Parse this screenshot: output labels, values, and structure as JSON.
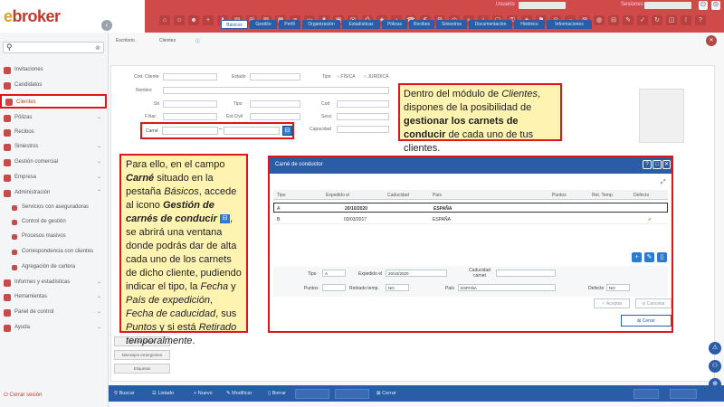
{
  "app": {
    "logo": "ebroker"
  },
  "header": {
    "user_label": "Usuario",
    "session_label": "Sesiones"
  },
  "sidebar": {
    "search_placeholder": "",
    "items": [
      {
        "label": "Invitaciones"
      },
      {
        "label": "Candidatos"
      },
      {
        "label": "Clientes"
      },
      {
        "label": "Pólizas"
      },
      {
        "label": "Recibos"
      },
      {
        "label": "Siniestros"
      },
      {
        "label": "Gestión comercial"
      },
      {
        "label": "Empresa"
      },
      {
        "label": "Administración"
      },
      {
        "label": "Servicios con aseguradoras"
      },
      {
        "label": "Control de gestión"
      },
      {
        "label": "Procesos masivos"
      },
      {
        "label": "Correspondencia con clientes"
      },
      {
        "label": "Agregación de cartera"
      },
      {
        "label": "Informes y estadísticas"
      },
      {
        "label": "Herramientas"
      },
      {
        "label": "Panel de control"
      },
      {
        "label": "Ayuda"
      }
    ],
    "logout": "Cerrar sesión"
  },
  "breadcrumb": {
    "a": "Escritorio",
    "b": "Clientes"
  },
  "tabs": [
    "Básicos",
    "Gestión",
    "Perfil",
    "Organización",
    "Estadísticas",
    "Pólizas",
    "Recibos",
    "Siniestros",
    "Documentación",
    "Histórico",
    "Informaciones"
  ],
  "form": {
    "cod_cliente": "Cód. Cliente",
    "estado": "Estado",
    "tipo": "Tipo",
    "fisica": "FÍSICA",
    "juridica": "JURÍDICA",
    "nombre": "Nombre",
    "sit": "Sit",
    "tipo2": "Tipo",
    "cod": "Cod",
    "f_nac": "F.Nac",
    "est_civil": "Est.Civil",
    "sexo": "Sexo",
    "capacidad": "Capacidad",
    "carne_label": "Carné",
    "dash": "–",
    "left_buttons": [
      "Conversiones",
      "Mensajes emergentes",
      "Etiquetas"
    ]
  },
  "callout1": {
    "p1": "Dentro del módulo de ",
    "em": "Clientes",
    "p2": ", dispones de la posibilidad de ",
    "b": "gestionar los carnets de conducir",
    "p3": " de cada uno de tus clientes."
  },
  "callout2": {
    "t1": "Para ello, en el campo ",
    "b1": "Carné",
    "t2": " situado en la pestaña ",
    "i1": "Básicos",
    "t3": ", accede al icono ",
    "b2": "Gestión de carnés de conducir",
    "t4": ", se abrirá una ventana donde podrás dar de alta cada uno de los carnets de dicho cliente, pudiendo indicar el tipo, la ",
    "i2": "Fecha",
    "t5": " y ",
    "i3": "País de expedición",
    "t6": ", ",
    "i4": "Fecha de caducidad",
    "t7": ", sus ",
    "i5": "Puntos",
    "t8": " y si está ",
    "i6": "Retirado temporalmente",
    "t9": "."
  },
  "modal": {
    "title": "Carné de conductor",
    "columns": [
      "Tipo",
      "Expedido el",
      "Caducidad",
      "País",
      "Puntos",
      "Ret. Temp.",
      "Defecto"
    ],
    "rows": [
      {
        "tipo": "A",
        "expedido": "20/10/2020",
        "caducidad": "",
        "pais": "ESPAÑA",
        "puntos": "",
        "ret": "",
        "defecto": ""
      },
      {
        "tipo": "B",
        "expedido": "03/03/2017",
        "caducidad": "",
        "pais": "ESPAÑA",
        "puntos": "",
        "ret": "",
        "defecto": "✔"
      }
    ],
    "form": {
      "tipo_label": "Tipo",
      "tipo_value": "A",
      "expedido_label": "Expedido el",
      "expedido_value": "20/10/2020",
      "caducidad_label": "Caducidad carnet",
      "caducidad_value": "",
      "puntos_label": "Puntos",
      "puntos_value": "",
      "retirado_label": "Retirado temp.",
      "retirado_value": "NO",
      "pais_label": "País",
      "pais_value": "ESPAÑA",
      "defecto_label": "Defecto",
      "defecto_value": "NO"
    },
    "aceptar": "Aceptar",
    "cancelar": "Cancelar",
    "cerrar": "Cerrar"
  },
  "bottombar": {
    "buscar": "Buscar",
    "listado": "Listado",
    "nuevo": "Nuevo",
    "modificar": "Modificar",
    "borrar": "Borrar",
    "cerrar": "Cerrar"
  }
}
